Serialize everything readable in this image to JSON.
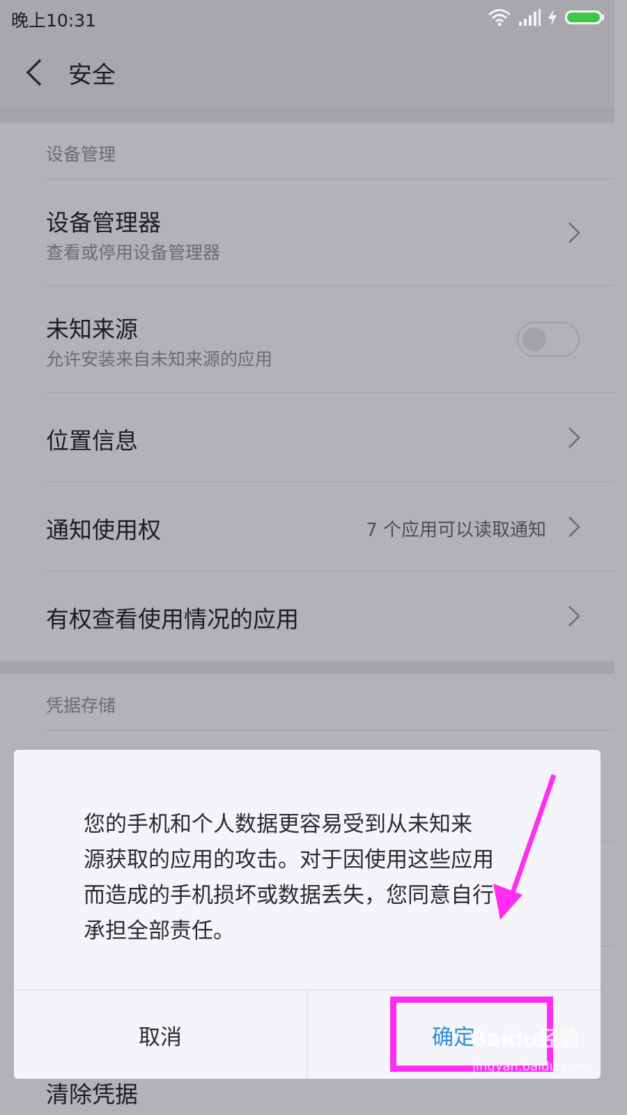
{
  "status_bar": {
    "time": "晚上10:31"
  },
  "header": {
    "title": "安全"
  },
  "sections": [
    {
      "header": "设备管理",
      "rows": [
        {
          "title": "设备管理器",
          "subtitle": "查看或停用设备管理器",
          "type": "chevron"
        },
        {
          "title": "未知来源",
          "subtitle": "允许安装来自未知来源的应用",
          "type": "toggle",
          "toggle_on": false
        },
        {
          "title": "位置信息",
          "type": "chevron"
        },
        {
          "title": "通知使用权",
          "value": "7 个应用可以读取通知",
          "type": "chevron"
        },
        {
          "title": "有权查看使用情况的应用",
          "type": "chevron"
        }
      ]
    },
    {
      "header": "凭据存储",
      "rows": [
        {
          "title": "清除凭据",
          "type": "partial"
        }
      ]
    }
  ],
  "dialog": {
    "message_lines": [
      "您的手机和个人数据更容易受到从未知来",
      "源获取的应用的攻击。对于因使用这些应用",
      "而造成的手机损坏或数据丢失，您同意自行",
      "承担全部责任。"
    ],
    "cancel_label": "取消",
    "ok_label": "确定"
  },
  "watermark": {
    "brand": "Baidu经验",
    "url": "jingyan.baidu.com"
  },
  "colors": {
    "accent": "#2f8fd8",
    "annotation": "#ff2ef2",
    "battery": "#3cc94a"
  }
}
